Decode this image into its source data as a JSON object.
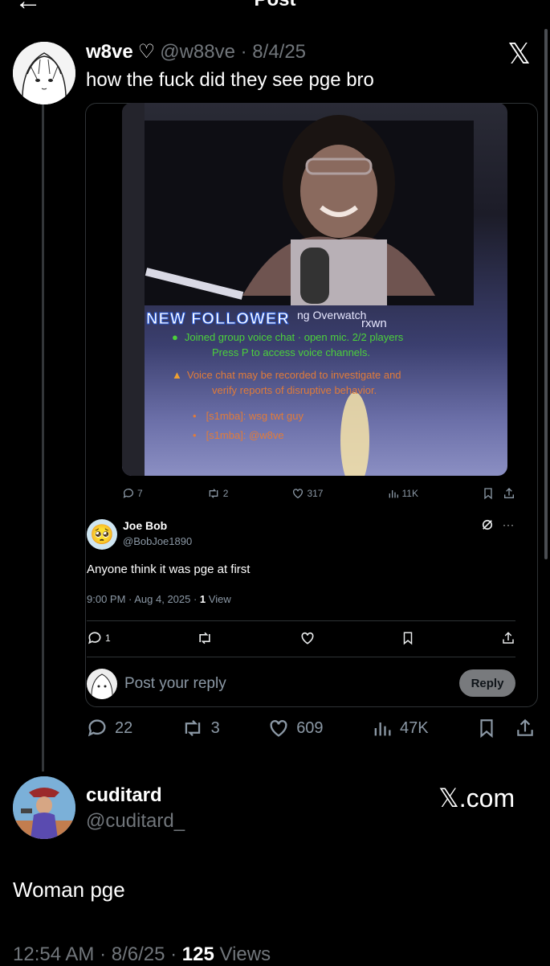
{
  "header": {
    "title": "Post",
    "back": "←",
    "more": "•••"
  },
  "op": {
    "name": "w8ve",
    "name_icon": "♡",
    "handle_time": "@w88ve · 8/4/25",
    "text": "how the fuck did they see pge bro",
    "brand_icon": "𝕏"
  },
  "embed": {
    "stream": {
      "new_follower": "NEW FOLLOWER",
      "overwatch": "ng Overwatch",
      "name_overlay": "rxwn",
      "line1": "Joined group voice chat · open mic. 2/2 players",
      "line2": "Press P to access voice channels.",
      "warn1": "Voice chat may be recorded to investigate and",
      "warn2": "verify reports of disruptive behavior.",
      "chat1": "[s1mba]: wsg twt guy",
      "chat2": "[s1mba]: @w8ve"
    },
    "inner_metrics": {
      "replies": "7",
      "reposts": "2",
      "likes": "317",
      "views": "11K"
    },
    "reply": {
      "name": "Joe Bob",
      "handle": "@BobJoe1890",
      "avatar_emoji": "🥺",
      "text": "Anyone think it was pge at first",
      "timestamp": "9:00 PM · Aug 4, 2025 · ",
      "views_count": "1",
      "views_label": "View",
      "replies": "1"
    },
    "composer": {
      "placeholder": "Post your reply",
      "reply_label": "Reply"
    }
  },
  "op_metrics": {
    "replies": "22",
    "reposts": "3",
    "likes": "609",
    "views": "47K"
  },
  "second": {
    "name": "cuditard",
    "handle": "@cuditard_",
    "brand": "𝕏.com",
    "text": "Woman pge",
    "time": "12:54 AM · 8/6/25 · ",
    "views_count": "125",
    "views_label": "Views"
  },
  "colors": {
    "background": "#000000",
    "muted": "#71767b",
    "border": "#2f3336"
  }
}
